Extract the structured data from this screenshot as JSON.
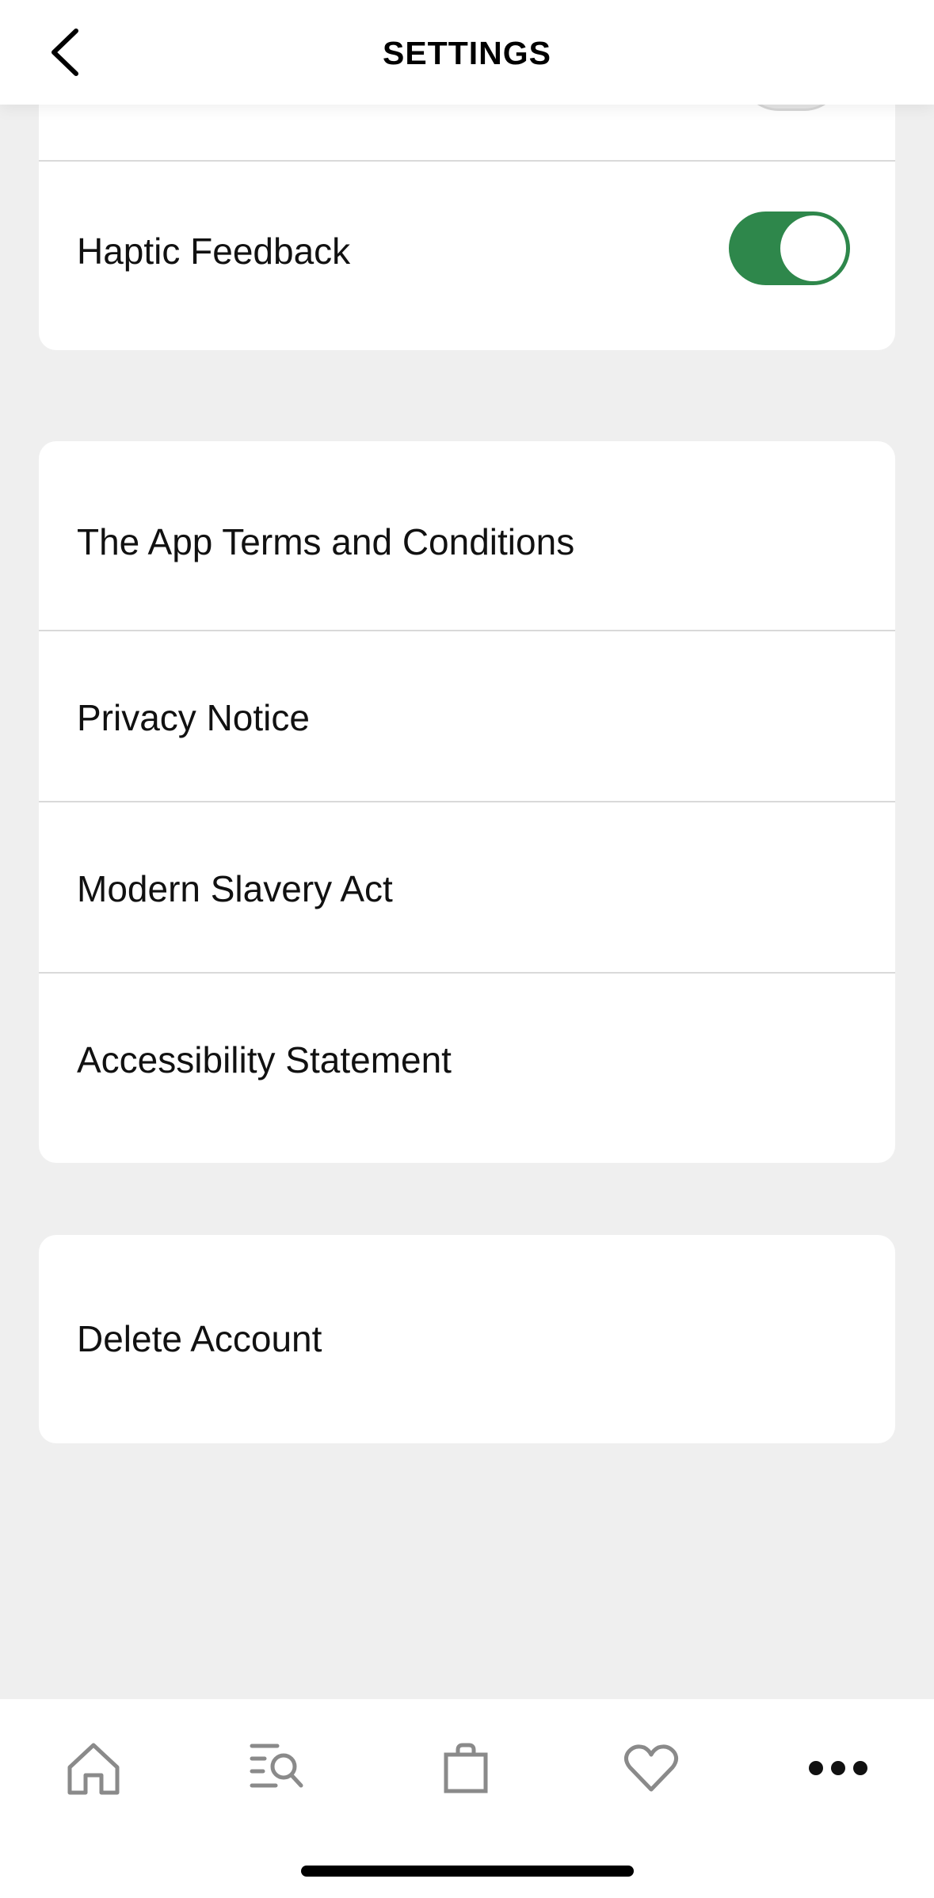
{
  "header": {
    "title": "SETTINGS",
    "back_icon": "chevron-left-icon"
  },
  "preferences": {
    "partial_toggle_state": "off",
    "haptic_label": "Haptic Feedback",
    "haptic_state": "on",
    "toggle_on_color": "#2e874b"
  },
  "legal": {
    "items": [
      {
        "label": "The App Terms and Conditions"
      },
      {
        "label": "Privacy Notice"
      },
      {
        "label": "Modern Slavery Act"
      },
      {
        "label": "Accessibility Statement"
      }
    ]
  },
  "account": {
    "delete_label": "Delete Account"
  },
  "tabbar": {
    "tabs": [
      {
        "icon": "home-icon",
        "active": false
      },
      {
        "icon": "search-list-icon",
        "active": false
      },
      {
        "icon": "bag-icon",
        "active": false
      },
      {
        "icon": "heart-icon",
        "active": false
      },
      {
        "icon": "more-icon",
        "active": true
      }
    ]
  }
}
